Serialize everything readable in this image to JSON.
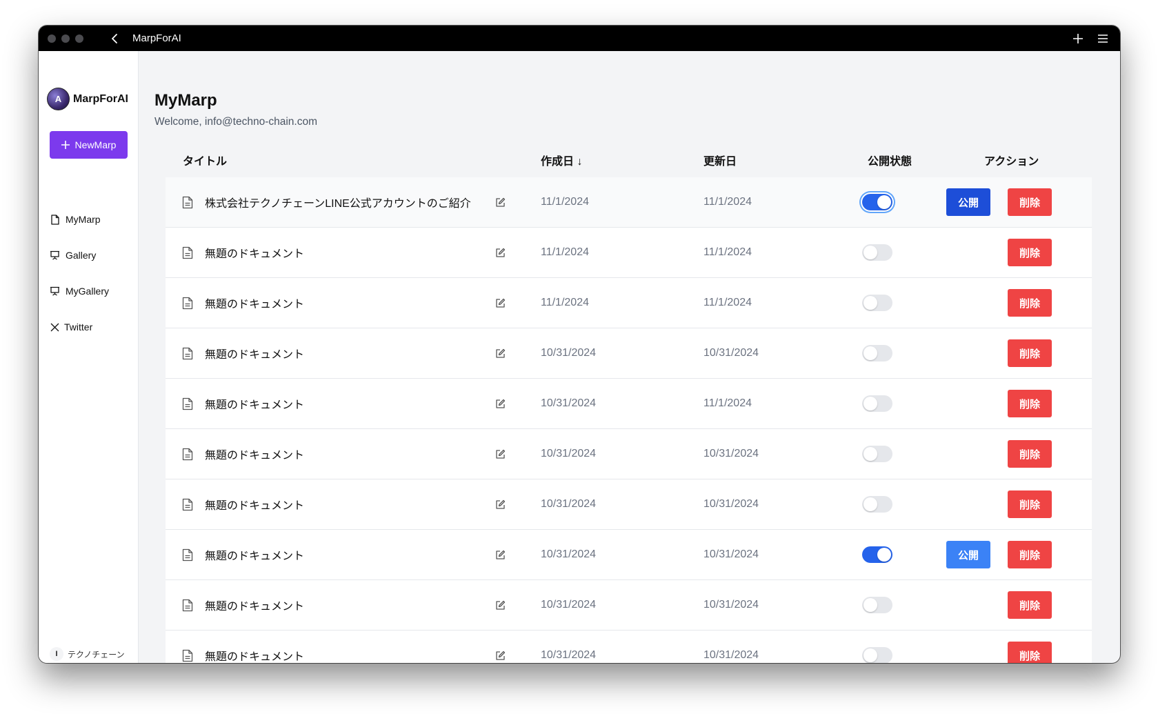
{
  "window": {
    "title": "MarpForAI"
  },
  "sidebar": {
    "brand": "MarpForAI",
    "new_button": "NewMarp",
    "items": [
      {
        "label": "MyMarp",
        "icon": "document-icon"
      },
      {
        "label": "Gallery",
        "icon": "presentation-icon"
      },
      {
        "label": "MyGallery",
        "icon": "presentation-icon"
      },
      {
        "label": "Twitter",
        "icon": "x-logo-icon"
      }
    ],
    "user": {
      "initial": "I",
      "name": "テクノチェーン"
    }
  },
  "main": {
    "title": "MyMarp",
    "welcome": "Welcome, info@techno-chain.com",
    "columns": {
      "title": "タイトル",
      "created": "作成日 ↓",
      "updated": "更新日",
      "status": "公開状態",
      "actions": "アクション"
    },
    "publish_label": "公開",
    "delete_label": "削除",
    "rows": [
      {
        "title": "株式会社テクノチェーンLINE公式アカウントのご紹介",
        "created": "11/1/2024",
        "updated": "11/1/2024",
        "published": true
      },
      {
        "title": "無題のドキュメント",
        "created": "11/1/2024",
        "updated": "11/1/2024",
        "published": false
      },
      {
        "title": "無題のドキュメント",
        "created": "11/1/2024",
        "updated": "11/1/2024",
        "published": false
      },
      {
        "title": "無題のドキュメント",
        "created": "10/31/2024",
        "updated": "10/31/2024",
        "published": false
      },
      {
        "title": "無題のドキュメント",
        "created": "10/31/2024",
        "updated": "11/1/2024",
        "published": false
      },
      {
        "title": "無題のドキュメント",
        "created": "10/31/2024",
        "updated": "10/31/2024",
        "published": false
      },
      {
        "title": "無題のドキュメント",
        "created": "10/31/2024",
        "updated": "10/31/2024",
        "published": false
      },
      {
        "title": "無題のドキュメント",
        "created": "10/31/2024",
        "updated": "10/31/2024",
        "published": true
      },
      {
        "title": "無題のドキュメント",
        "created": "10/31/2024",
        "updated": "10/31/2024",
        "published": false
      },
      {
        "title": "無題のドキュメント",
        "created": "10/31/2024",
        "updated": "10/31/2024",
        "published": false
      }
    ]
  }
}
